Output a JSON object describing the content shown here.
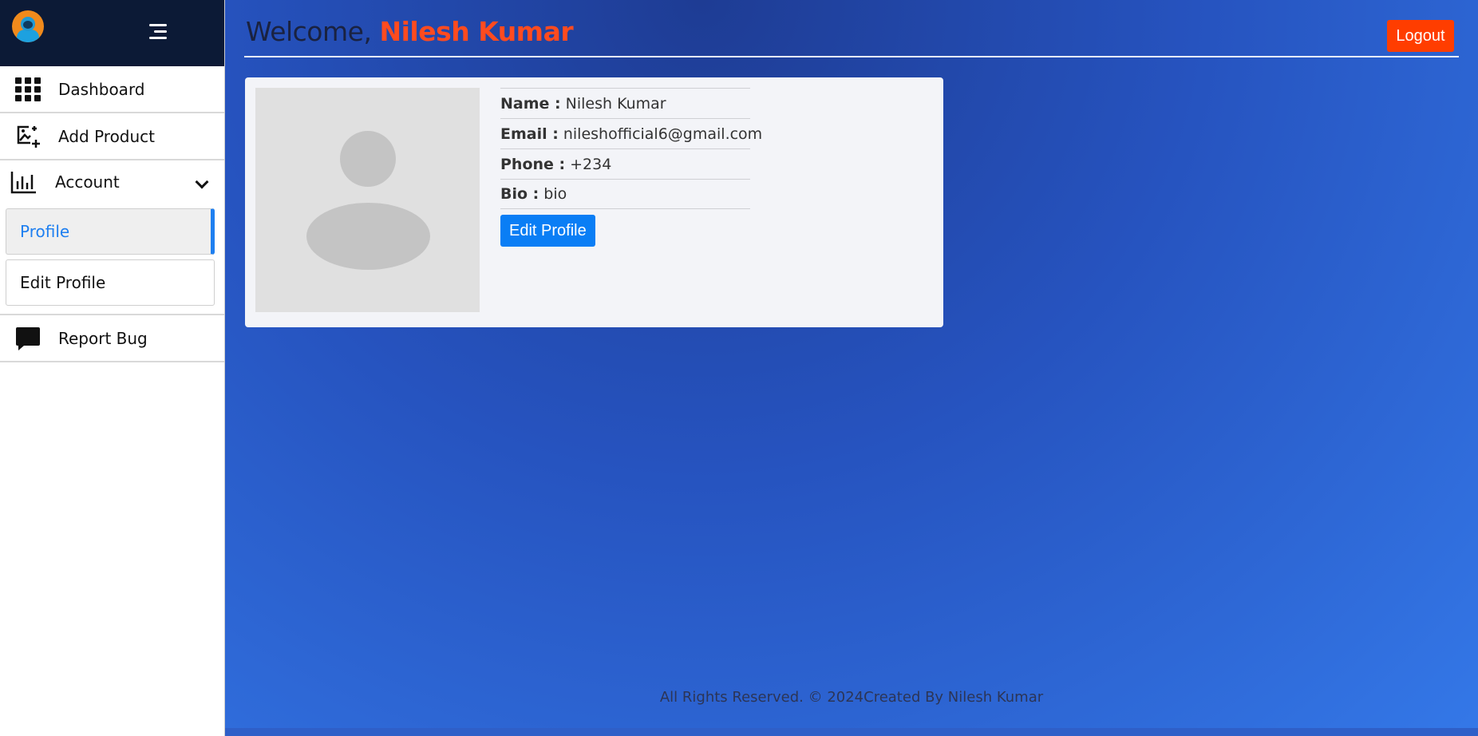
{
  "sidebar": {
    "logo_icon": "avatar-logo-icon",
    "menu_icon": "hamburger-menu-icon",
    "items": [
      {
        "label": "Dashboard",
        "icon": "grid-icon"
      },
      {
        "label": "Add Product",
        "icon": "add-image-icon"
      },
      {
        "label": "Account",
        "icon": "bar-chart-icon",
        "expanded": true,
        "children": [
          {
            "label": "Profile",
            "active": true
          },
          {
            "label": "Edit Profile",
            "active": false
          }
        ]
      },
      {
        "label": "Report Bug",
        "icon": "chat-bubble-icon"
      }
    ]
  },
  "header": {
    "welcome_prefix": "Welcome,",
    "user_name": "Nilesh Kumar",
    "logout_label": "Logout"
  },
  "profile": {
    "name_label": "Name :",
    "name_value": "Nilesh Kumar",
    "email_label": "Email :",
    "email_value": "nileshofficial6@gmail.com",
    "phone_label": "Phone :",
    "phone_value": "+234",
    "bio_label": "Bio :",
    "bio_value": "bio",
    "edit_button_label": "Edit Profile"
  },
  "footer": {
    "text": "All Rights Reserved. © 2024Created By Nilesh Kumar"
  },
  "colors": {
    "accent_orange": "#ff4b1f",
    "logout_bg": "#ff3d00",
    "primary_blue": "#0a7ef5",
    "active_link": "#1e7ff0",
    "sidebar_top": "#0c1a36"
  }
}
